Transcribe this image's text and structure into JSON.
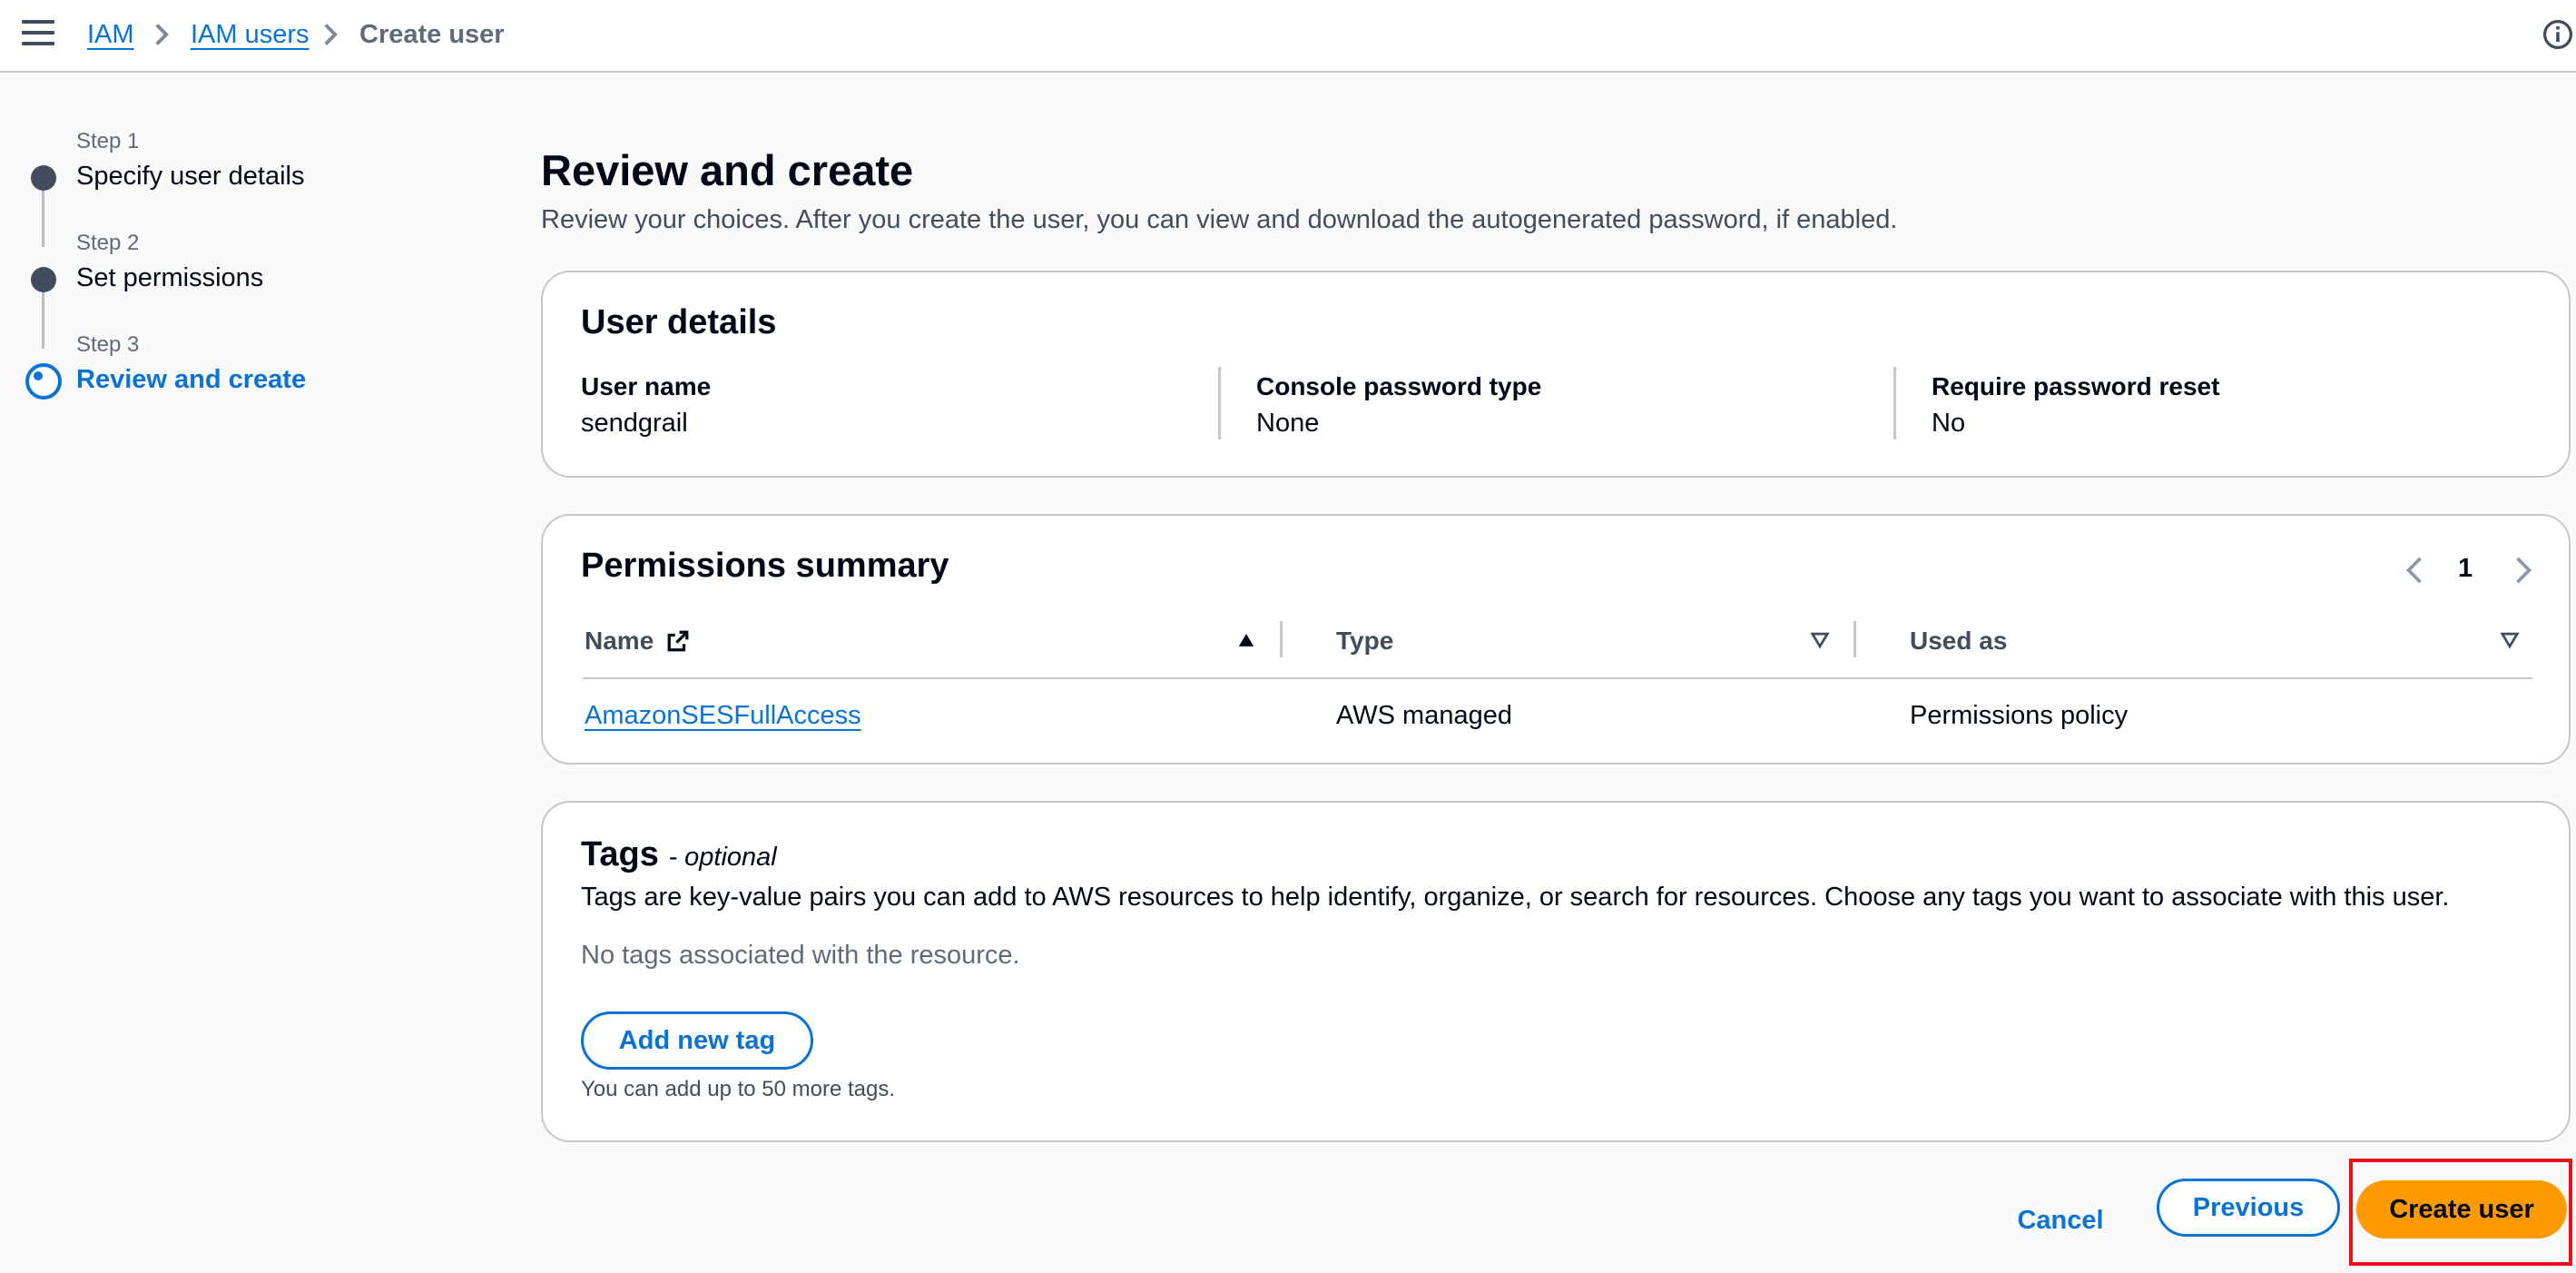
{
  "breadcrumb": {
    "items": [
      {
        "label": "IAM"
      },
      {
        "label": "IAM users"
      },
      {
        "label": "Create user"
      }
    ]
  },
  "steps": [
    {
      "label": "Step 1",
      "title": "Specify user details",
      "state": "complete"
    },
    {
      "label": "Step 2",
      "title": "Set permissions",
      "state": "complete"
    },
    {
      "label": "Step 3",
      "title": "Review and create",
      "state": "active"
    }
  ],
  "page": {
    "title": "Review and create",
    "description": "Review your choices. After you create the user, you can view and download the autogenerated password, if enabled."
  },
  "user_details": {
    "title": "User details",
    "fields": [
      {
        "label": "User name",
        "value": "sendgrail"
      },
      {
        "label": "Console password type",
        "value": "None"
      },
      {
        "label": "Require password reset",
        "value": "No"
      }
    ]
  },
  "permissions": {
    "title": "Permissions summary",
    "page_number": "1",
    "columns": [
      "Name",
      "Type",
      "Used as"
    ],
    "rows": [
      {
        "name": "AmazonSESFullAccess",
        "type": "AWS managed",
        "used_as": "Permissions policy"
      }
    ]
  },
  "tags": {
    "title": "Tags",
    "optional": "- optional",
    "description": "Tags are key-value pairs you can add to AWS resources to help identify, organize, or search for resources. Choose any tags you want to associate with this user.",
    "empty_text": "No tags associated with the resource.",
    "add_button": "Add new tag",
    "hint": "You can add up to 50 more tags."
  },
  "footer": {
    "cancel": "Cancel",
    "previous": "Previous",
    "create": "Create user"
  },
  "colors": {
    "link": "#0972d3",
    "primary_button": "#ff9900",
    "highlight": "#e8101a"
  }
}
